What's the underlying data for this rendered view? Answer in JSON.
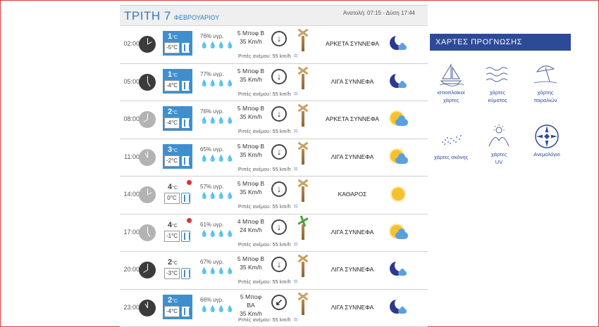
{
  "header": {
    "day": "ΤΡΙΤΗ 7",
    "month": "ΦΕΒΡΟΥΑΡΙΟΥ",
    "sun_times": "Ανατολή: 07:15 - Δύση 17:44"
  },
  "rows": [
    {
      "time": "02:00",
      "hi": "1",
      "unit": "°C",
      "lo": "-5°C",
      "hum": "76% υγρ.",
      "wind1": "5 Μποφ Β",
      "wind2": "35 Km/h",
      "gust": "Ριπές ανέμου: 55 km/h",
      "cond": "ΑΡΚΕΤΑ ΣΥΝΝΕΦΑ",
      "arrow": "↓",
      "icon": "moon-cloud-icon"
    },
    {
      "time": "05:00",
      "hi": "1",
      "unit": "°C",
      "lo": "-4°C",
      "hum": "77% υγρ.",
      "wind1": "5 Μποφ Β",
      "wind2": "35 Km/h",
      "gust": "Ριπές ανέμου: 55 km/h",
      "cond": "ΛΙΓΑ ΣΥΝΝΕΦΑ",
      "arrow": "↓",
      "icon": "moon-cloud-icon"
    },
    {
      "time": "08:00",
      "hi": "2",
      "unit": "°C",
      "lo": "-4°C",
      "hum": "76% υγρ.",
      "wind1": "5 Μποφ Β",
      "wind2": "35 Km/h",
      "gust": "Ριπές ανέμου: 55 km/h",
      "cond": "ΑΡΚΕΤΑ ΣΥΝΝΕΦΑ",
      "arrow": "↓",
      "icon": "sun-cloud-icon"
    },
    {
      "time": "11:00",
      "hi": "3",
      "unit": "°C",
      "lo": "-2°C",
      "hum": "65% υγρ.",
      "wind1": "5 Μποφ Β",
      "wind2": "35 Km/h",
      "gust": "Ριπές ανέμου: 55 km/h",
      "cond": "ΛΙΓΑ ΣΥΝΝΕΦΑ",
      "arrow": "↓",
      "icon": "sun-cloud-icon"
    },
    {
      "time": "14:00",
      "hi": "4",
      "unit": "°C",
      "lo": "0°C",
      "hum": "57% υγρ.",
      "wind1": "5 Μποφ Β",
      "wind2": "35 Km/h",
      "gust": "Ριπές ανέμου: 55 km/h",
      "cond": "ΚΑΘΑΡΟΣ",
      "arrow": "↓",
      "icon": "sun-icon"
    },
    {
      "time": "17:00",
      "hi": "4",
      "unit": "°C",
      "lo": "-1°C",
      "hum": "61% υγρ.",
      "wind1": "4 Μποφ Β",
      "wind2": "24 Km/h",
      "gust": "Ριπές ανέμου: 55 km/h",
      "cond": "ΛΙΓΑ ΣΥΝΝΕΦΑ",
      "arrow": "↓",
      "icon": "sun-cloud-icon"
    },
    {
      "time": "20:00",
      "hi": "2",
      "unit": "°C",
      "lo": "-3°C",
      "hum": "67% υγρ.",
      "wind1": "5 Μποφ Β",
      "wind2": "35 Km/h",
      "gust": "Ριπές ανέμου: 55 km/h",
      "cond": "ΛΙΓΑ ΣΥΝΝΕΦΑ",
      "arrow": "↓",
      "icon": "moon-cloud-icon"
    },
    {
      "time": "23:00",
      "hi": "2",
      "unit": "°C",
      "lo": "-4°C",
      "hum": "66% υγρ.",
      "wind1": "5 Μποφ ΒΑ",
      "wind2": "35 Km/h",
      "gust": "Ριπές ανέμου: 55 km/h",
      "cond": "ΛΙΓΑ ΣΥΝΝΕΦΑ",
      "arrow": "↙",
      "icon": "moon-cloud-icon"
    }
  ],
  "maps": {
    "title": "ΧΑΡΤΕΣ ΠΡΟΓΝΩΣΗΣ",
    "items": [
      {
        "line1": "ιστιοπλοϊκοί",
        "line2": "χάρτες"
      },
      {
        "line1": "χάρτες",
        "line2": "κύματος"
      },
      {
        "line1": "χάρτης",
        "line2": "παραλιών"
      },
      {
        "line1": "χάρτες σκόνης",
        "line2": ""
      },
      {
        "line1": "χάρτες",
        "line2": "UV"
      },
      {
        "line1": "Ανεμολόγιο",
        "line2": ""
      }
    ]
  },
  "colors": {
    "accent": "#2d7cc1",
    "panel": "#2d4a99",
    "temp_box": "#3f8fcf",
    "alert": "#e03030"
  }
}
